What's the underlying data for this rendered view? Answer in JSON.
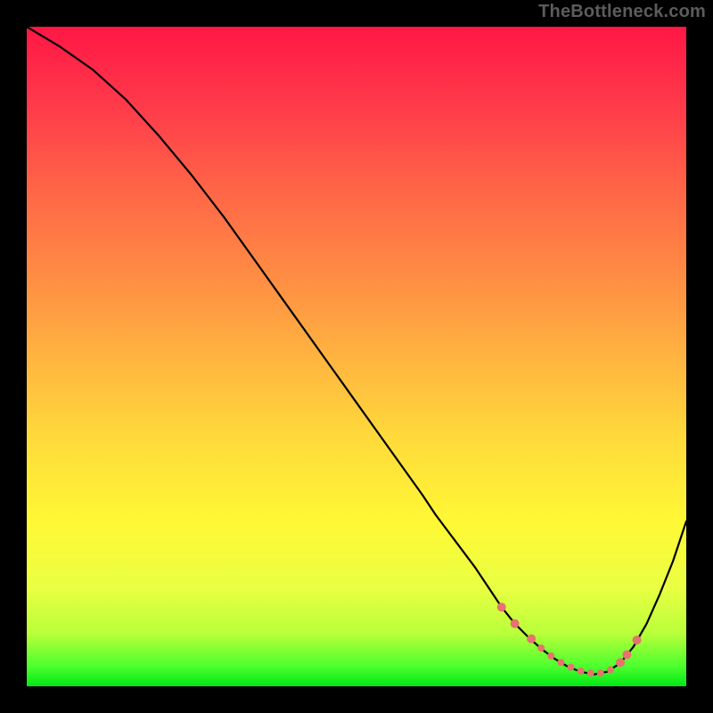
{
  "watermark": "TheBottleneck.com",
  "chart_data": {
    "type": "line",
    "title": "",
    "xlabel": "",
    "ylabel": "",
    "xlim": [
      0,
      100
    ],
    "ylim": [
      0,
      100
    ],
    "grid": false,
    "series": [
      {
        "name": "curve",
        "x": [
          0,
          5,
          10,
          15,
          20,
          25,
          30,
          35,
          40,
          45,
          50,
          55,
          60,
          62,
          65,
          68,
          70,
          72,
          74,
          76,
          78,
          80,
          82,
          84,
          86,
          88,
          90,
          92,
          94,
          96,
          98,
          100
        ],
        "y": [
          100,
          97,
          93.5,
          89,
          83.5,
          77.5,
          71,
          64,
          57,
          50,
          43,
          36,
          29,
          26,
          22,
          18,
          15,
          12,
          9.5,
          7.5,
          5.7,
          4.2,
          3.0,
          2.2,
          1.8,
          2.2,
          3.5,
          6.0,
          9.5,
          14,
          19,
          25
        ]
      }
    ],
    "markers": {
      "name": "bottleneck-range",
      "color": "#e6736e",
      "points": [
        {
          "x": 72,
          "y": 12.0,
          "r": 5
        },
        {
          "x": 74,
          "y": 9.5,
          "r": 5
        },
        {
          "x": 76.5,
          "y": 7.2,
          "r": 5
        },
        {
          "x": 78,
          "y": 5.8,
          "r": 4
        },
        {
          "x": 79.5,
          "y": 4.6,
          "r": 4
        },
        {
          "x": 81,
          "y": 3.6,
          "r": 4
        },
        {
          "x": 82.5,
          "y": 2.9,
          "r": 4
        },
        {
          "x": 84,
          "y": 2.3,
          "r": 4
        },
        {
          "x": 85.5,
          "y": 2.0,
          "r": 4
        },
        {
          "x": 87,
          "y": 2.0,
          "r": 4
        },
        {
          "x": 88.5,
          "y": 2.5,
          "r": 4
        },
        {
          "x": 90,
          "y": 3.6,
          "r": 5
        },
        {
          "x": 91,
          "y": 4.8,
          "r": 5
        },
        {
          "x": 92.5,
          "y": 7.0,
          "r": 5
        }
      ]
    }
  }
}
